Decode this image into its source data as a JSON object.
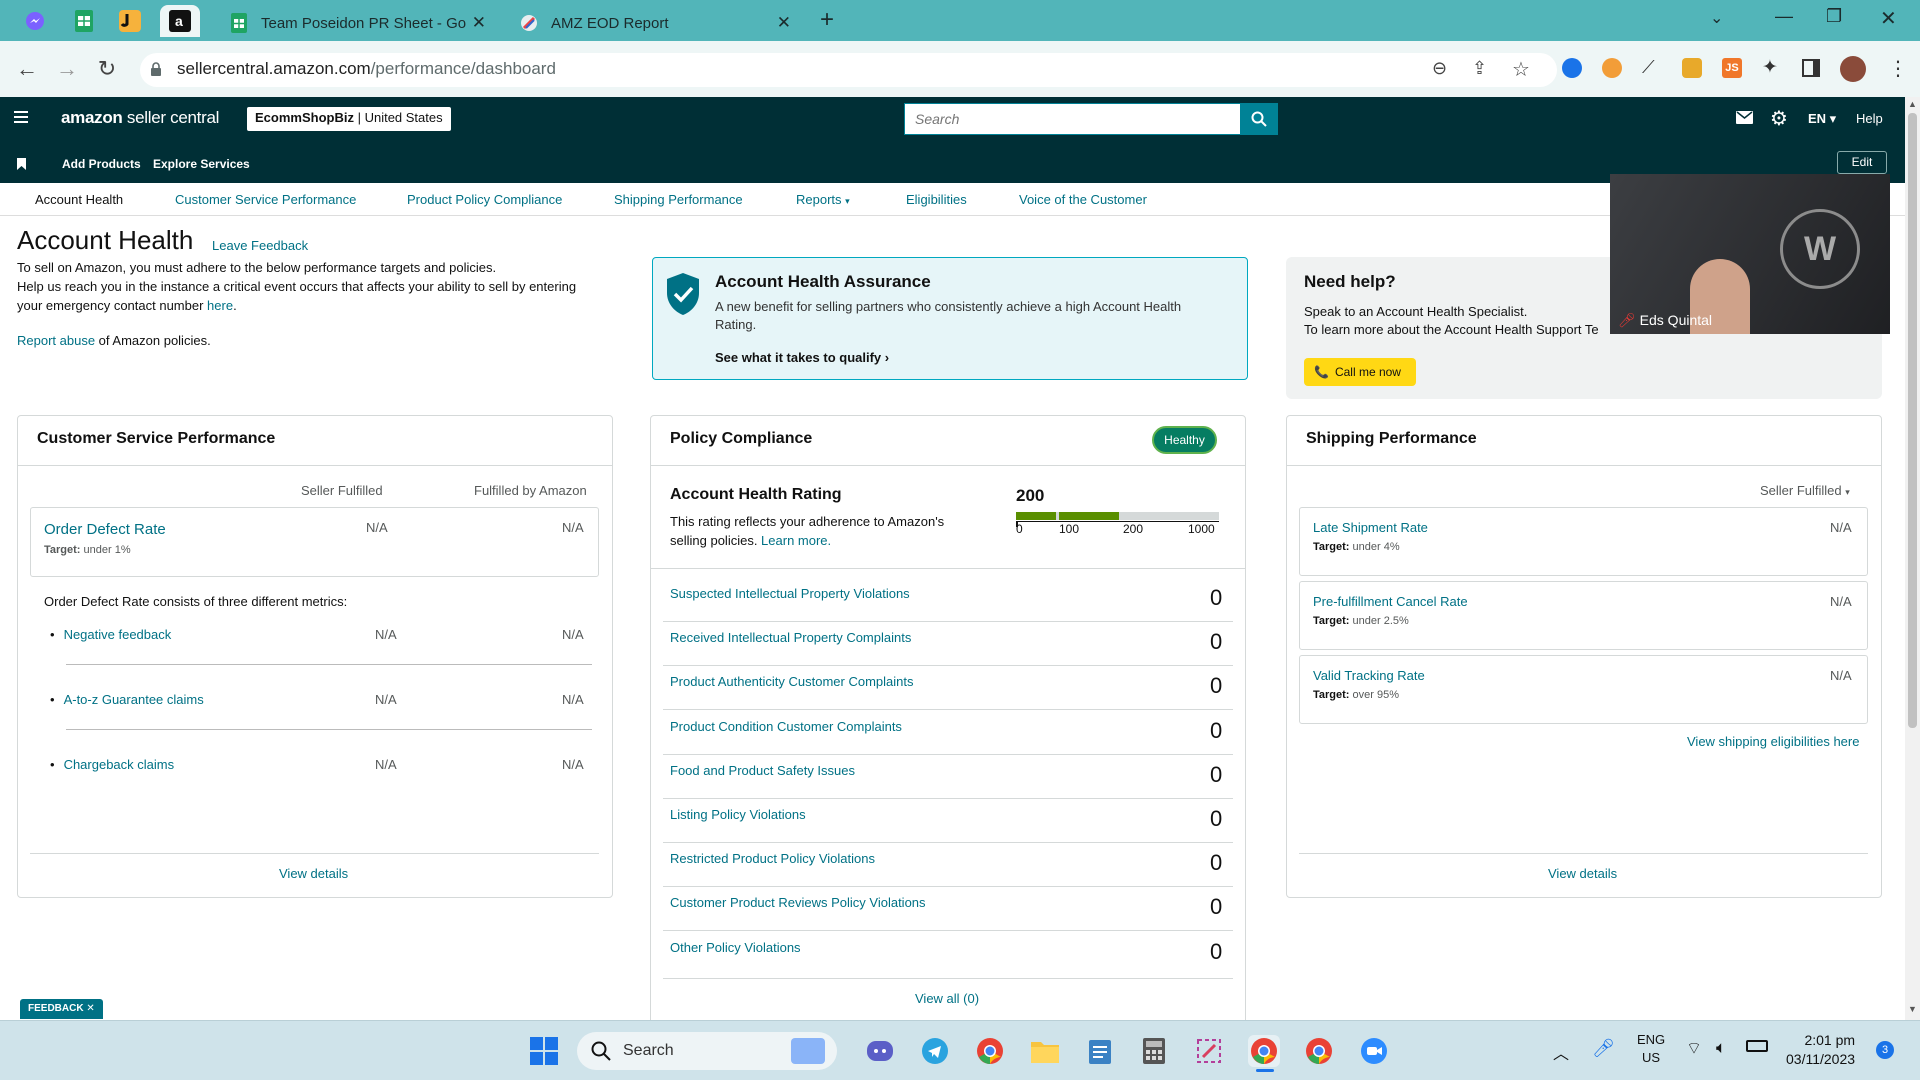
{
  "browser": {
    "tabs": [
      {
        "label": "Team Poseidon PR Sheet - Goog",
        "icon": "google-sheets-icon"
      },
      {
        "label": "AMZ EOD Report",
        "icon": "link-icon"
      }
    ],
    "url_host": "sellercentral.amazon.com",
    "url_path": "/performance/dashboard"
  },
  "amazon_header": {
    "logo_word1": "amazon",
    "logo_word2": " seller central",
    "store_name": "EcommShopBiz",
    "store_region": " | United States",
    "search_placeholder": "Search",
    "language": "EN",
    "help": "Help",
    "shortcuts": [
      "Add Products",
      "Explore Services"
    ],
    "edit": "Edit"
  },
  "subnav": [
    "Account Health",
    "Customer Service Performance",
    "Product Policy Compliance",
    "Shipping Performance",
    "Reports",
    "Eligibilities",
    "Voice of the Customer"
  ],
  "page": {
    "title": "Account Health",
    "leave_feedback": "Leave Feedback",
    "intro_line1": "To sell on Amazon, you must adhere to the below performance targets and policies.",
    "intro_line2": "Help us reach you in the instance a critical event occurs that affects your ability to sell by entering",
    "intro_line3": "your emergency contact number ",
    "here": "here",
    "report_abuse": "Report abuse",
    "report_abuse_suffix": " of Amazon policies."
  },
  "aha": {
    "title": "Account Health Assurance",
    "text": "A new benefit for selling partners who consistently achieve a high Account Health Rating.",
    "cta": "See what it takes to qualify"
  },
  "help_box": {
    "title": "Need help?",
    "line1": "Speak to an Account Health Specialist.",
    "line2": "To learn more about the Account Health Support Te",
    "button": "Call me now"
  },
  "video_overlay": {
    "name": "Eds Quintal"
  },
  "csp": {
    "title": "Customer Service Performance",
    "col1": "Seller Fulfilled",
    "col2": "Fulfilled by Amazon",
    "odr_label": "Order Defect Rate",
    "odr_target_prefix": "Target:",
    "odr_target": " under 1%",
    "odr_v1": "N/A",
    "odr_v2": "N/A",
    "consists": "Order Defect Rate consists of three different metrics:",
    "metrics": [
      {
        "label": "Negative feedback",
        "v1": "N/A",
        "v2": "N/A"
      },
      {
        "label": "A-to-z Guarantee claims",
        "v1": "N/A",
        "v2": "N/A"
      },
      {
        "label": "Chargeback claims",
        "v1": "N/A",
        "v2": "N/A"
      }
    ],
    "view_details": "View details"
  },
  "policy": {
    "title": "Policy Compliance",
    "badge": "Healthy",
    "rating_title": "Account Health Rating",
    "rating_text1": "This rating reflects your adherence to Amazon's",
    "rating_text2": "selling policies. ",
    "learn_more": "Learn more.",
    "rating_value": "200",
    "scale": [
      "0",
      "100",
      "200",
      "1000"
    ],
    "rows": [
      {
        "label": "Suspected Intellectual Property Violations",
        "count": "0"
      },
      {
        "label": "Received Intellectual Property Complaints",
        "count": "0"
      },
      {
        "label": "Product Authenticity Customer Complaints",
        "count": "0"
      },
      {
        "label": "Product Condition Customer Complaints",
        "count": "0"
      },
      {
        "label": "Food and Product Safety Issues",
        "count": "0"
      },
      {
        "label": "Listing Policy Violations",
        "count": "0"
      },
      {
        "label": "Restricted Product Policy Violations",
        "count": "0"
      },
      {
        "label": "Customer Product Reviews Policy Violations",
        "count": "0"
      },
      {
        "label": "Other Policy Violations",
        "count": "0"
      }
    ],
    "view_all": "View all (0)"
  },
  "shipping": {
    "title": "Shipping Performance",
    "filter": "Seller Fulfilled",
    "metrics": [
      {
        "label": "Late Shipment Rate",
        "target_prefix": "Target:",
        "target": " under 4%",
        "value": "N/A"
      },
      {
        "label": "Pre-fulfillment Cancel Rate",
        "target_prefix": "Target:",
        "target": " under 2.5%",
        "value": "N/A"
      },
      {
        "label": "Valid Tracking Rate",
        "target_prefix": "Target:",
        "target": " over 95%",
        "value": "N/A"
      }
    ],
    "eligibilities": "View shipping eligibilities here",
    "view_details": "View details"
  },
  "feedback": "FEEDBACK",
  "taskbar": {
    "search": "Search",
    "lang1": "ENG",
    "lang2": "US",
    "time": "2:01 pm",
    "date": "03/11/2023",
    "notif": "3"
  }
}
